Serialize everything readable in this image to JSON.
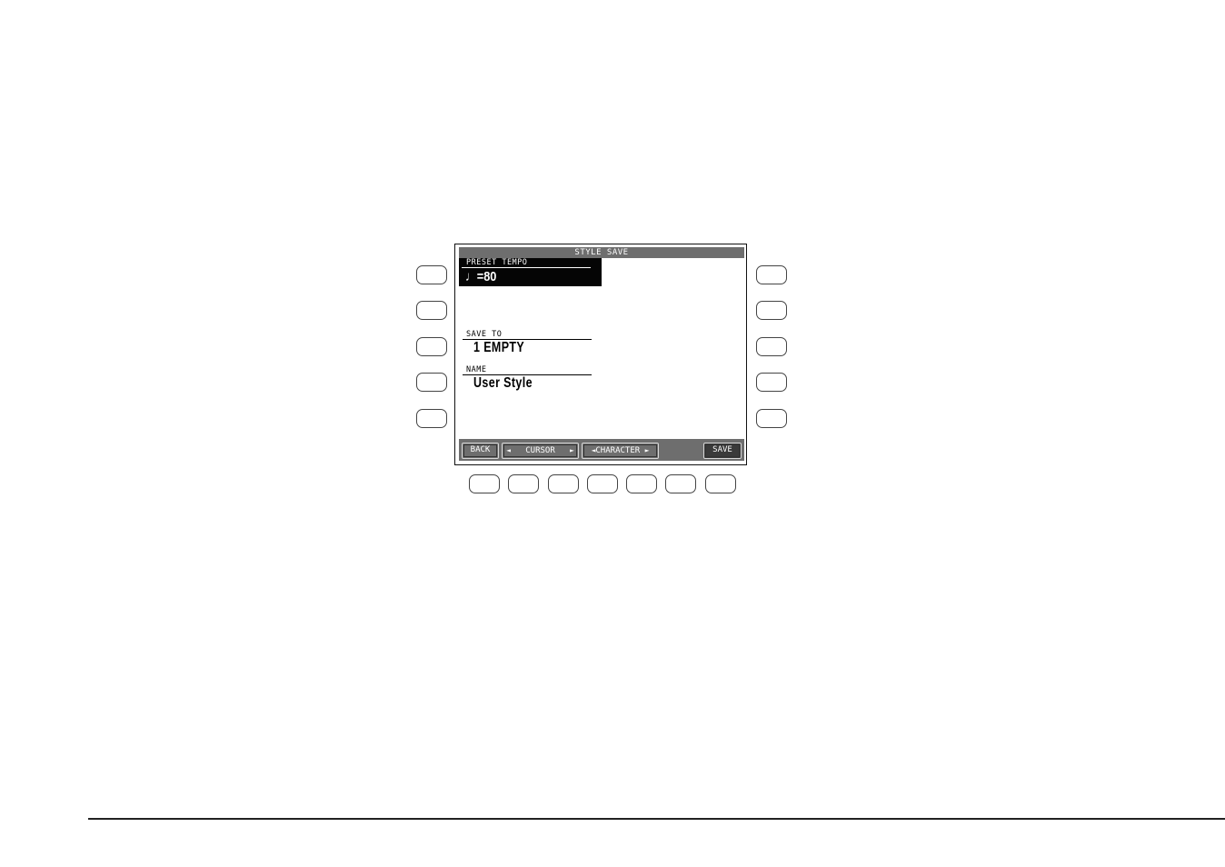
{
  "screen": {
    "title": "STYLE SAVE",
    "preset_tempo": {
      "label": "PRESET TEMPO",
      "value": "♩=80"
    },
    "save_to": {
      "label": "SAVE TO",
      "value": "1 EMPTY"
    },
    "name": {
      "label": "NAME",
      "value": "User Style"
    },
    "soft_buttons": {
      "back": "BACK",
      "cursor": "CURSOR",
      "character": "CHARACTER",
      "save": "SAVE",
      "left_arrow": "◄",
      "right_arrow": "►"
    }
  },
  "colors": {
    "titlebar": "#6e6e6e",
    "highlight": "#050505",
    "softbar": "#6e6e6e",
    "save_button": "#3a3a3a"
  }
}
